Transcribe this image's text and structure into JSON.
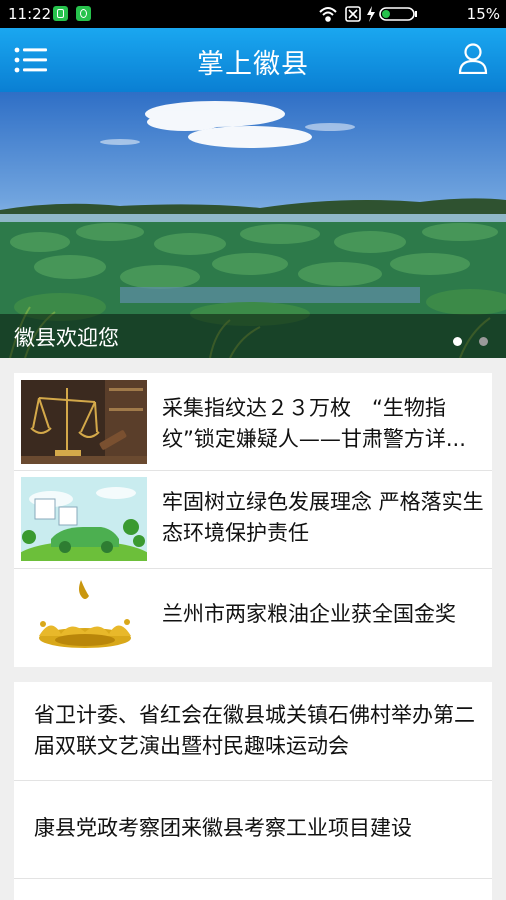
{
  "status_bar": {
    "time": "11:22",
    "battery": "15%"
  },
  "header": {
    "title": "掌上徽县"
  },
  "banner": {
    "caption": "徽县欢迎您"
  },
  "news": [
    {
      "title": "采集指纹达２３万枚　“生物指纹”锁定嫌疑人——甘肃警方详..."
    },
    {
      "title": "牢固树立绿色发展理念 严格落实生态环境保护责任"
    },
    {
      "title": "兰州市两家粮油企业获全国金奖"
    }
  ],
  "text_news": [
    {
      "title": "省卫计委、省红会在徽县城关镇石佛村举办第二届双联文艺演出暨村民趣味运动会"
    },
    {
      "title": "康县党政考察团来徽县考察工业项目建设"
    }
  ],
  "colors": {
    "accent": "#0a8bdd",
    "active_dot": "#ffffff",
    "inactive_dot": "#9a9a9a"
  }
}
